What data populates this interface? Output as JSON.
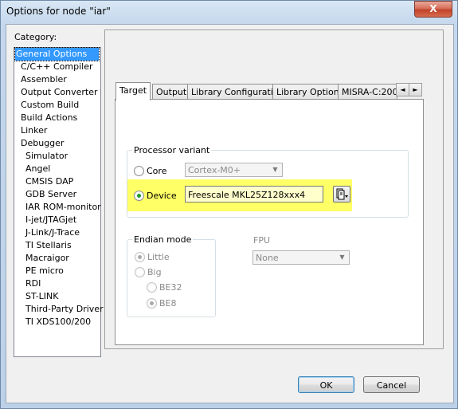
{
  "window": {
    "title": "Options for node \"iar\"",
    "close_label": "X"
  },
  "category": {
    "label": "Category:",
    "items": [
      "General Options",
      "C/C++ Compiler",
      "Assembler",
      "Output Converter",
      "Custom Build",
      "Build Actions",
      "Linker",
      "Debugger",
      "Simulator",
      "Angel",
      "CMSIS DAP",
      "GDB Server",
      "IAR ROM-monitor",
      "I-jet/JTAGjet",
      "J-Link/J-Trace",
      "TI Stellaris",
      "Macraigor",
      "PE micro",
      "RDI",
      "ST-LINK",
      "Third-Party Driver",
      "TI XDS100/200"
    ],
    "selected": "General Options"
  },
  "tabs": [
    "Target",
    "Output",
    "Library Configuration",
    "Library Options",
    "MISRA-C:200"
  ],
  "tab_scroll": {
    "left": "◄",
    "right": "►"
  },
  "processor": {
    "legend": "Processor variant",
    "core_label": "Core",
    "core_value": "Cortex-M0+",
    "device_label": "Device",
    "device_value": "Freescale MKL25Z128xxx4",
    "selected": "Device"
  },
  "endian": {
    "legend": "Endian mode",
    "little_label": "Little",
    "big_label": "Big",
    "be32_label": "BE32",
    "be8_label": "BE8"
  },
  "fpu": {
    "label": "FPU",
    "value": "None"
  },
  "buttons": {
    "ok": "OK",
    "cancel": "Cancel"
  },
  "colors": {
    "highlight": "#ffff66",
    "selection": "#3399ff",
    "radio_dot": "#1d9a2a"
  },
  "icons": {
    "dropdown": "▼",
    "device_browse": "device-browse-icon"
  }
}
